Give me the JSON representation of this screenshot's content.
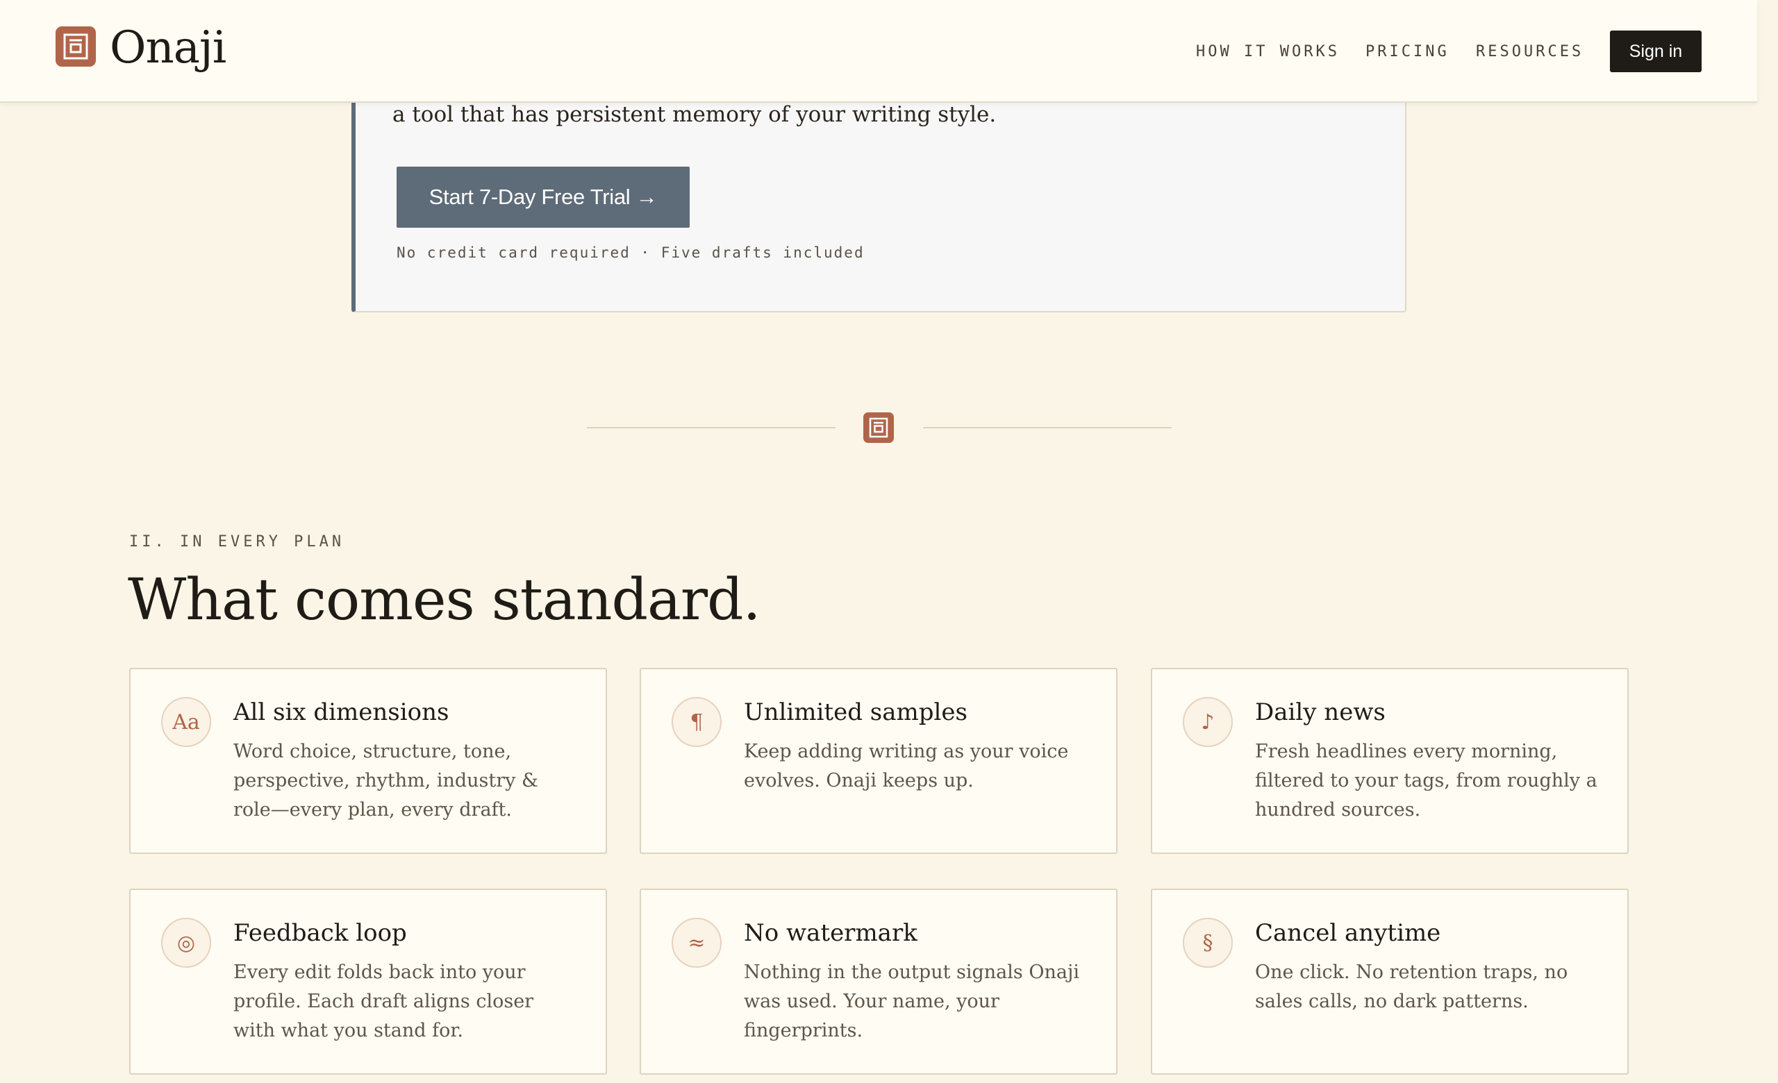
{
  "header": {
    "brand": "Onaji",
    "nav": [
      "HOW IT WORKS",
      "PRICING",
      "RESOURCES"
    ],
    "signin_label": "Sign in"
  },
  "cta": {
    "text": "a tool that has persistent memory of your writing style.",
    "button_label": "Start 7-Day Free Trial →",
    "note": "No credit card required · Five drafts included"
  },
  "section": {
    "eyebrow": "II. IN EVERY PLAN",
    "title": "What comes standard."
  },
  "features": [
    {
      "icon": "Aa",
      "icon_name": "typography-icon",
      "title": "All six dimensions",
      "desc": "Word choice, structure, tone, perspective, rhythm, industry & role—every plan, every draft."
    },
    {
      "icon": "¶",
      "icon_name": "pilcrow-icon",
      "title": "Unlimited samples",
      "desc": "Keep adding writing as your voice evolves. Onaji keeps up."
    },
    {
      "icon": "♪",
      "icon_name": "music-note-icon",
      "title": "Daily news",
      "desc": "Fresh headlines every morning, filtered to your tags, from roughly a hundred sources."
    },
    {
      "icon": "◎",
      "icon_name": "target-icon",
      "title": "Feedback loop",
      "desc": "Every edit folds back into your profile. Each draft aligns closer with what you stand for."
    },
    {
      "icon": "≈",
      "icon_name": "wave-icon",
      "title": "No watermark",
      "desc": "Nothing in the output signals Onaji was used. Your name, your fingerprints."
    },
    {
      "icon": "§",
      "icon_name": "section-sign-icon",
      "title": "Cancel anytime",
      "desc": "One click. No retention traps, no sales calls, no dark patterns."
    }
  ],
  "colors": {
    "accent": "#b0654a",
    "slate": "#5e6b78",
    "background": "#faf5e6",
    "card": "#fefcf3"
  }
}
